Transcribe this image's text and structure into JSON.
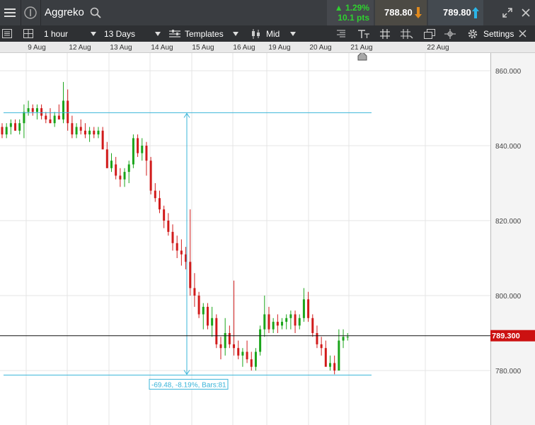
{
  "header": {
    "instrument": "Aggreko",
    "change_pct": "▲ 1.29%",
    "change_pts": "10.1 pts",
    "sell_price": "788.80",
    "buy_price": "789.80",
    "colors": {
      "up": "#2fd12f",
      "sell_arrow": "#e08a1e",
      "buy_arrow": "#2bb5e8"
    }
  },
  "toolbar": {
    "interval": "1 hour",
    "range": "13 Days",
    "templates": "Templates",
    "price_type": "Mid",
    "settings": "Settings"
  },
  "date_axis": {
    "labels": [
      "9 Aug",
      "12 Aug",
      "13 Aug",
      "14 Aug",
      "15 Aug",
      "16 Aug",
      "19 Aug",
      "20 Aug",
      "21 Aug",
      "22 Aug"
    ]
  },
  "chart_data": {
    "type": "candlestick",
    "ylim": [
      774,
      862
    ],
    "y_ticks": [
      "860.000",
      "840.000",
      "820.000",
      "800.000",
      "780.000"
    ],
    "y_tick_values": [
      860,
      840,
      820,
      800,
      780
    ],
    "current_price": 789.3,
    "current_price_label": "789.300",
    "measure": {
      "top": 848.8,
      "bottom": 778.8,
      "label": "-69.48, -8.19%, Bars:81"
    },
    "colors": {
      "up": "#1aa51a",
      "down": "#d11b1b",
      "measure": "#39b4d8",
      "grid": "#e4e4e4"
    },
    "candles": [
      [
        845,
        846,
        842,
        843
      ],
      [
        843,
        846,
        842,
        845
      ],
      [
        845,
        847,
        843,
        846
      ],
      [
        846,
        847,
        844,
        844
      ],
      [
        844,
        847,
        843,
        846
      ],
      [
        846,
        851,
        842,
        849
      ],
      [
        849,
        852,
        848,
        850
      ],
      [
        850,
        851,
        848,
        849
      ],
      [
        849,
        851,
        847,
        850
      ],
      [
        850,
        851,
        847,
        848
      ],
      [
        848,
        849,
        846,
        847
      ],
      [
        847,
        850,
        846,
        846
      ],
      [
        846,
        849,
        845,
        848
      ],
      [
        848,
        851,
        847,
        847
      ],
      [
        847,
        857,
        846,
        852
      ],
      [
        852,
        855,
        844,
        846
      ],
      [
        846,
        848,
        842,
        843
      ],
      [
        843,
        846,
        842,
        845
      ],
      [
        845,
        847,
        843,
        844
      ],
      [
        844,
        846,
        842,
        843
      ],
      [
        843,
        845,
        841,
        844
      ],
      [
        844,
        845,
        842,
        843
      ],
      [
        843,
        845,
        842,
        844
      ],
      [
        844,
        845,
        840,
        839
      ],
      [
        839,
        841,
        834,
        834
      ],
      [
        834,
        838,
        833,
        836
      ],
      [
        835,
        837,
        831,
        832
      ],
      [
        832,
        834,
        829,
        831
      ],
      [
        831,
        834,
        829,
        833
      ],
      [
        833,
        836,
        830,
        835
      ],
      [
        835,
        843,
        834,
        842
      ],
      [
        842,
        843,
        837,
        838
      ],
      [
        838,
        842,
        836,
        840
      ],
      [
        840,
        841,
        832,
        836
      ],
      [
        836,
        837,
        827,
        828
      ],
      [
        828,
        830,
        825,
        826
      ],
      [
        826,
        828,
        822,
        823
      ],
      [
        823,
        824,
        818,
        820
      ],
      [
        820,
        822,
        816,
        817
      ],
      [
        817,
        819,
        812,
        814
      ],
      [
        814,
        816,
        810,
        812
      ],
      [
        812,
        815,
        808,
        811
      ],
      [
        811,
        813,
        807,
        809
      ],
      [
        809,
        823,
        800,
        802
      ],
      [
        802,
        806,
        797,
        800
      ],
      [
        800,
        801,
        794,
        795
      ],
      [
        795,
        798,
        791,
        797
      ],
      [
        797,
        798,
        791,
        792
      ],
      [
        792,
        797,
        789,
        794
      ],
      [
        794,
        795,
        786,
        787
      ],
      [
        787,
        789,
        783,
        786
      ],
      [
        786,
        794,
        784,
        790
      ],
      [
        790,
        792,
        786,
        787
      ],
      [
        787,
        804,
        784,
        786
      ],
      [
        786,
        788,
        783,
        784
      ],
      [
        784,
        786,
        781,
        785
      ],
      [
        785,
        788,
        782,
        783
      ],
      [
        783,
        785,
        780,
        781
      ],
      [
        781,
        786,
        780,
        785
      ],
      [
        785,
        792,
        784,
        791
      ],
      [
        791,
        800,
        789,
        795
      ],
      [
        795,
        797,
        790,
        791
      ],
      [
        791,
        794,
        790,
        793
      ],
      [
        793,
        795,
        790,
        792
      ],
      [
        792,
        794,
        791,
        793
      ],
      [
        793,
        795,
        791,
        794
      ],
      [
        794,
        796,
        791,
        795
      ],
      [
        795,
        796,
        790,
        792
      ],
      [
        792,
        795,
        791,
        794
      ],
      [
        794,
        802,
        793,
        799
      ],
      [
        799,
        801,
        793,
        794
      ],
      [
        794,
        795,
        789,
        790
      ],
      [
        790,
        792,
        786,
        787
      ],
      [
        787,
        789,
        784,
        786
      ],
      [
        786,
        788,
        782,
        781
      ],
      [
        781,
        784,
        780,
        782
      ],
      [
        782,
        784,
        779,
        780
      ],
      [
        780,
        791,
        784,
        788
      ],
      [
        788,
        791,
        786,
        789
      ],
      [
        789,
        790,
        788,
        789
      ]
    ]
  }
}
